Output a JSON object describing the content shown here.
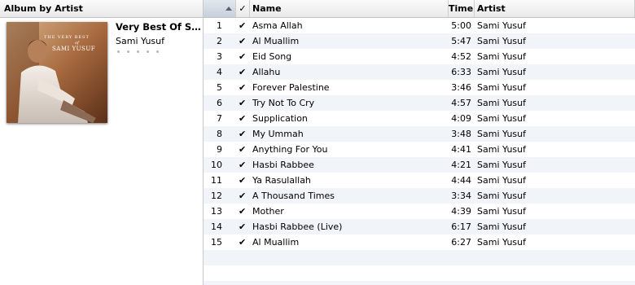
{
  "browser": {
    "header_label": "Album by Artist"
  },
  "album": {
    "title": "Very Best Of Sami Yusuf",
    "artist": "Sami Yusuf",
    "cover_line1": "THE VERY BEST",
    "cover_line2": "of",
    "cover_line3": "SAMI YUSUF",
    "rating_dots": 5
  },
  "columns": {
    "check": "✓",
    "name": "Name",
    "time": "Time",
    "artist": "Artist"
  },
  "tracks": [
    {
      "num": "1",
      "name": "Asma Allah",
      "time": "5:00",
      "artist": "Sami Yusuf"
    },
    {
      "num": "2",
      "name": "Al Muallim",
      "time": "5:47",
      "artist": "Sami Yusuf"
    },
    {
      "num": "3",
      "name": "Eid Song",
      "time": "4:52",
      "artist": "Sami Yusuf"
    },
    {
      "num": "4",
      "name": "Allahu",
      "time": "6:33",
      "artist": "Sami Yusuf"
    },
    {
      "num": "5",
      "name": "Forever Palestine",
      "time": "3:46",
      "artist": "Sami Yusuf"
    },
    {
      "num": "6",
      "name": "Try Not To Cry",
      "time": "4:57",
      "artist": "Sami Yusuf"
    },
    {
      "num": "7",
      "name": "Supplication",
      "time": "4:09",
      "artist": "Sami Yusuf"
    },
    {
      "num": "8",
      "name": "My Ummah",
      "time": "3:48",
      "artist": "Sami Yusuf"
    },
    {
      "num": "9",
      "name": "Anything For You",
      "time": "4:41",
      "artist": "Sami Yusuf"
    },
    {
      "num": "10",
      "name": "Hasbi Rabbee",
      "time": "4:21",
      "artist": "Sami Yusuf"
    },
    {
      "num": "11",
      "name": "Ya Rasulallah",
      "time": "4:44",
      "artist": "Sami Yusuf"
    },
    {
      "num": "12",
      "name": "A Thousand Times",
      "time": "3:34",
      "artist": "Sami Yusuf"
    },
    {
      "num": "13",
      "name": "Mother",
      "time": "4:39",
      "artist": "Sami Yusuf"
    },
    {
      "num": "14",
      "name": "Hasbi Rabbee (Live)",
      "time": "6:17",
      "artist": "Sami Yusuf"
    },
    {
      "num": "15",
      "name": "Al Muallim",
      "time": "6:27",
      "artist": "Sami Yusuf"
    }
  ],
  "check_mark": "✔",
  "colors": {
    "row_alt": "#f1f5fa",
    "sorted_header": "#c6cfdb"
  }
}
